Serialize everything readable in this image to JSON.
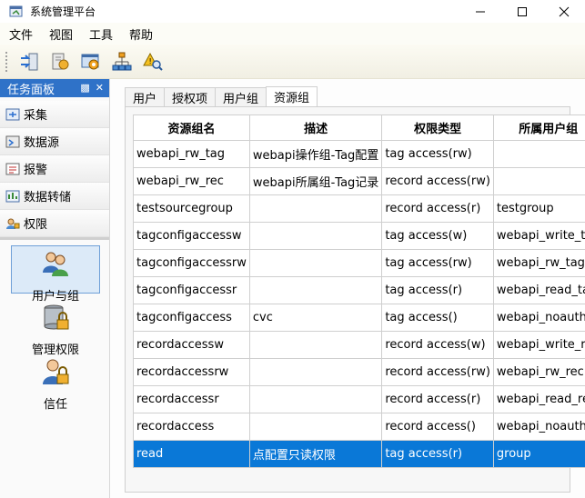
{
  "window": {
    "title": "系统管理平台"
  },
  "menu": [
    "文件",
    "视图",
    "工具",
    "帮助"
  ],
  "toolbar_icons": [
    "import-export-icon",
    "edit-tool-icon",
    "config-icon",
    "network-icon",
    "alert-search-icon"
  ],
  "task_panel": {
    "title": "任务面板",
    "items": [
      {
        "label": "采集",
        "icon": "collect-icon"
      },
      {
        "label": "数据源",
        "icon": "datasource-icon"
      },
      {
        "label": "报警",
        "icon": "alarm-icon"
      },
      {
        "label": "数据转储",
        "icon": "data-dump-icon"
      },
      {
        "label": "权限",
        "icon": "permission-icon"
      }
    ],
    "big_items": [
      {
        "label": "用户与组",
        "icon": "users-groups-icon",
        "selected": true
      },
      {
        "label": "管理权限",
        "icon": "admin-permission-icon",
        "selected": false
      },
      {
        "label": "信任",
        "icon": "trust-icon",
        "selected": false
      }
    ]
  },
  "tabs": [
    "用户",
    "授权项",
    "用户组",
    "资源组"
  ],
  "active_tab": "资源组",
  "table": {
    "columns": [
      "资源组名",
      "描述",
      "权限类型",
      "所属用户组"
    ],
    "rows": [
      [
        "webapi_rw_tag",
        "webapi操作组-Tag配置",
        "tag access(rw)",
        ""
      ],
      [
        "webapi_rw_rec",
        "webapi所属组-Tag记录",
        "record access(rw)",
        ""
      ],
      [
        "testsourcegroup",
        "",
        "record access(r)",
        "testgroup"
      ],
      [
        "tagconfigaccessw",
        "",
        "tag access(w)",
        "webapi_write_tag"
      ],
      [
        "tagconfigaccessrw",
        "",
        "tag access(rw)",
        "webapi_rw_tag"
      ],
      [
        "tagconfigaccessr",
        "",
        "tag access(r)",
        "webapi_read_tag"
      ],
      [
        "tagconfigaccess",
        "cvc",
        "tag access()",
        "webapi_noauth"
      ],
      [
        "recordaccessw",
        "",
        "record access(w)",
        "webapi_write_rec"
      ],
      [
        "recordaccessrw",
        "",
        "record access(rw)",
        "webapi_rw_rec"
      ],
      [
        "recordaccessr",
        "",
        "record access(r)",
        "webapi_read_rec"
      ],
      [
        "recordaccess",
        "",
        "record access()",
        "webapi_noauth"
      ],
      [
        "read",
        "点配置只读权限",
        "tag access(r)",
        "group"
      ]
    ],
    "selected_row": 11
  },
  "colors": {
    "accent": "#2f72c8",
    "selection": "#0a78d7"
  }
}
